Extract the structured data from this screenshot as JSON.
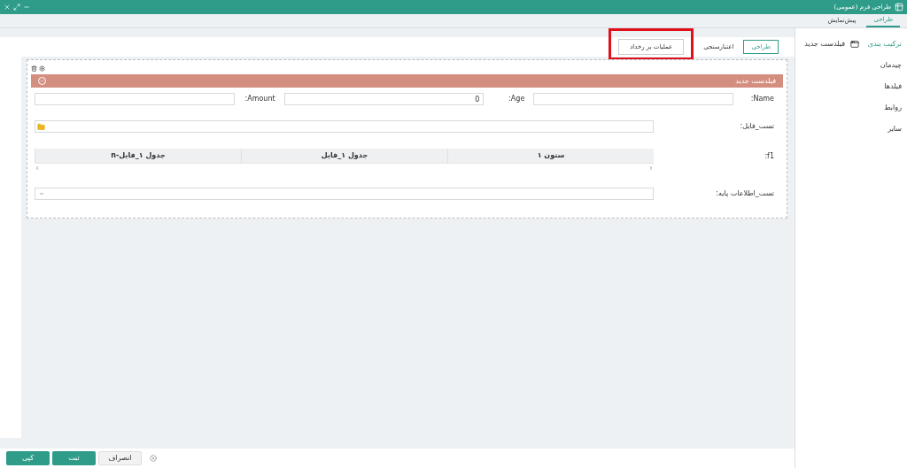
{
  "window": {
    "title": "طراحی فرم (عمومی)"
  },
  "tabs": [
    {
      "label": "طراحی",
      "selected": true
    },
    {
      "label": "پیش‌نمایش",
      "selected": false
    }
  ],
  "sidebar": {
    "items": [
      {
        "label": "ترکیب بندی",
        "selected": true
      },
      {
        "label": "چیدمان",
        "selected": false
      },
      {
        "label": "فیلدها",
        "selected": false
      },
      {
        "label": "روابط",
        "selected": false
      },
      {
        "label": "سایر",
        "selected": false
      }
    ],
    "components": [
      {
        "label": "فیلدست جدید"
      }
    ]
  },
  "toolbar": {
    "buttons": [
      {
        "label": "طراحی",
        "selected": true,
        "highlighted": false
      },
      {
        "label": "اعتبارسنجی",
        "selected": false,
        "highlighted": false
      },
      {
        "label": "عملیات بر رخداد",
        "selected": false,
        "highlighted": true
      }
    ]
  },
  "fieldset": {
    "title": "فیلدست جدید",
    "inline_fields": [
      {
        "label": ":Name"
      },
      {
        "label": ":Age",
        "value": "0"
      },
      {
        "label": ":Amount"
      }
    ],
    "file_field": {
      "label": "تست_فایل:"
    },
    "table_field": {
      "label": ":f1",
      "columns": [
        "ستون ۱",
        "جدول ۱_فایل",
        "جدول ۱_فایل-n"
      ]
    },
    "select_field": {
      "label": "تست_اطلاعات پایه:"
    }
  },
  "footer": {
    "buttons": [
      {
        "label": "انصراف",
        "kind": "secondary"
      },
      {
        "label": "ثبت",
        "kind": "primary"
      },
      {
        "label": "کپی",
        "kind": "primary"
      }
    ]
  }
}
